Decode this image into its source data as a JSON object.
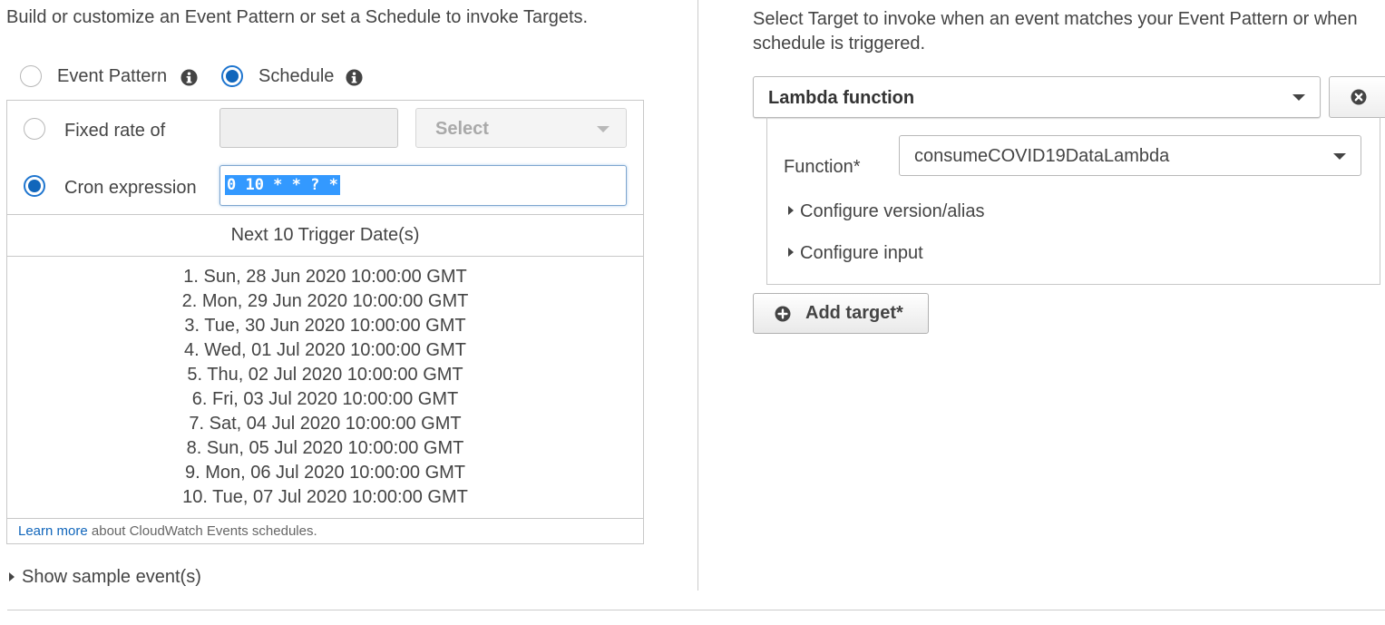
{
  "event_source": {
    "description": "Build or customize an Event Pattern or set a Schedule to invoke Targets.",
    "options": [
      {
        "label": "Event Pattern",
        "selected": false,
        "icon": "info-icon"
      },
      {
        "label": "Schedule",
        "selected": true,
        "icon": "info-icon"
      }
    ],
    "schedule": {
      "fixed_rate": {
        "label": "Fixed rate of",
        "selected": false,
        "value": "",
        "unit_placeholder": "Select"
      },
      "cron": {
        "label": "Cron expression",
        "selected": true,
        "value": "0 10 * * ? *"
      },
      "next_dates_header": "Next 10 Trigger Date(s)",
      "next_dates": [
        "1. Sun, 28 Jun 2020 10:00:00 GMT",
        "2. Mon, 29 Jun 2020 10:00:00 GMT",
        "3. Tue, 30 Jun 2020 10:00:00 GMT",
        "4. Wed, 01 Jul 2020 10:00:00 GMT",
        "5. Thu, 02 Jul 2020 10:00:00 GMT",
        "6. Fri, 03 Jul 2020 10:00:00 GMT",
        "7. Sat, 04 Jul 2020 10:00:00 GMT",
        "8. Sun, 05 Jul 2020 10:00:00 GMT",
        "9. Mon, 06 Jul 2020 10:00:00 GMT",
        "10. Tue, 07 Jul 2020 10:00:00 GMT"
      ],
      "learn_more_link": "Learn more",
      "learn_more_suffix": " about CloudWatch Events schedules."
    },
    "show_sample_events": "Show sample event(s)"
  },
  "targets": {
    "description_line1": "Select Target to invoke when an event matches your Event Pattern or when",
    "description_line2": "schedule is triggered.",
    "target_type": "Lambda function",
    "function_label": "Function*",
    "function_value": "consumeCOVID19DataLambda",
    "configure_version": "Configure version/alias",
    "configure_input": "Configure input",
    "add_target": "Add target*"
  },
  "colors": {
    "accent": "#1166bb",
    "text": "#444444",
    "border": "#c8c8c8",
    "selection": "#3399ff"
  }
}
